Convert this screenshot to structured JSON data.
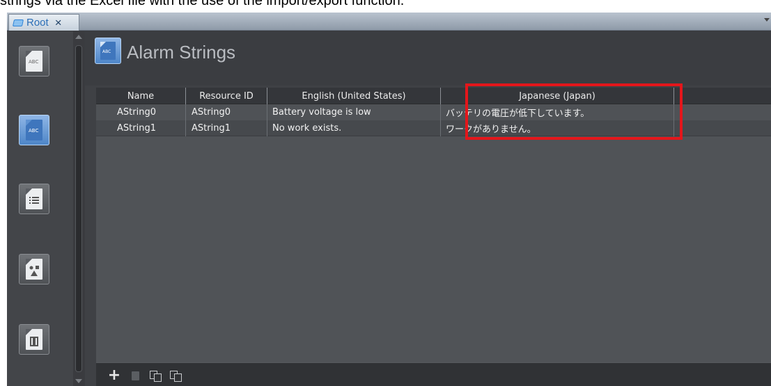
{
  "caption": "strings via the Excel file with the use of the import/export function.",
  "tabs": [
    {
      "label": "Root",
      "close": "×"
    }
  ],
  "nav": {
    "items": [
      {
        "name": "string-resource",
        "glyph": "ABC"
      },
      {
        "name": "alarm-strings",
        "glyph": "ABC",
        "active": true
      },
      {
        "name": "list"
      },
      {
        "name": "images"
      },
      {
        "name": "media"
      }
    ]
  },
  "page": {
    "title": "Alarm Strings",
    "icon_glyph": "ABC"
  },
  "table": {
    "columns": [
      "Name",
      "Resource ID",
      "English (United States)",
      "Japanese (Japan)"
    ],
    "rows": [
      [
        "AString0",
        "AString0",
        "Battery voltage is low",
        "バッテリの電圧が低下しています。"
      ],
      [
        "AString1",
        "AString1",
        "No work exists.",
        "ワークがありません。"
      ]
    ]
  },
  "toolbar": {
    "add_label": "+"
  },
  "colors": {
    "highlight": "#e4161b",
    "accent": "#4e86c8"
  }
}
